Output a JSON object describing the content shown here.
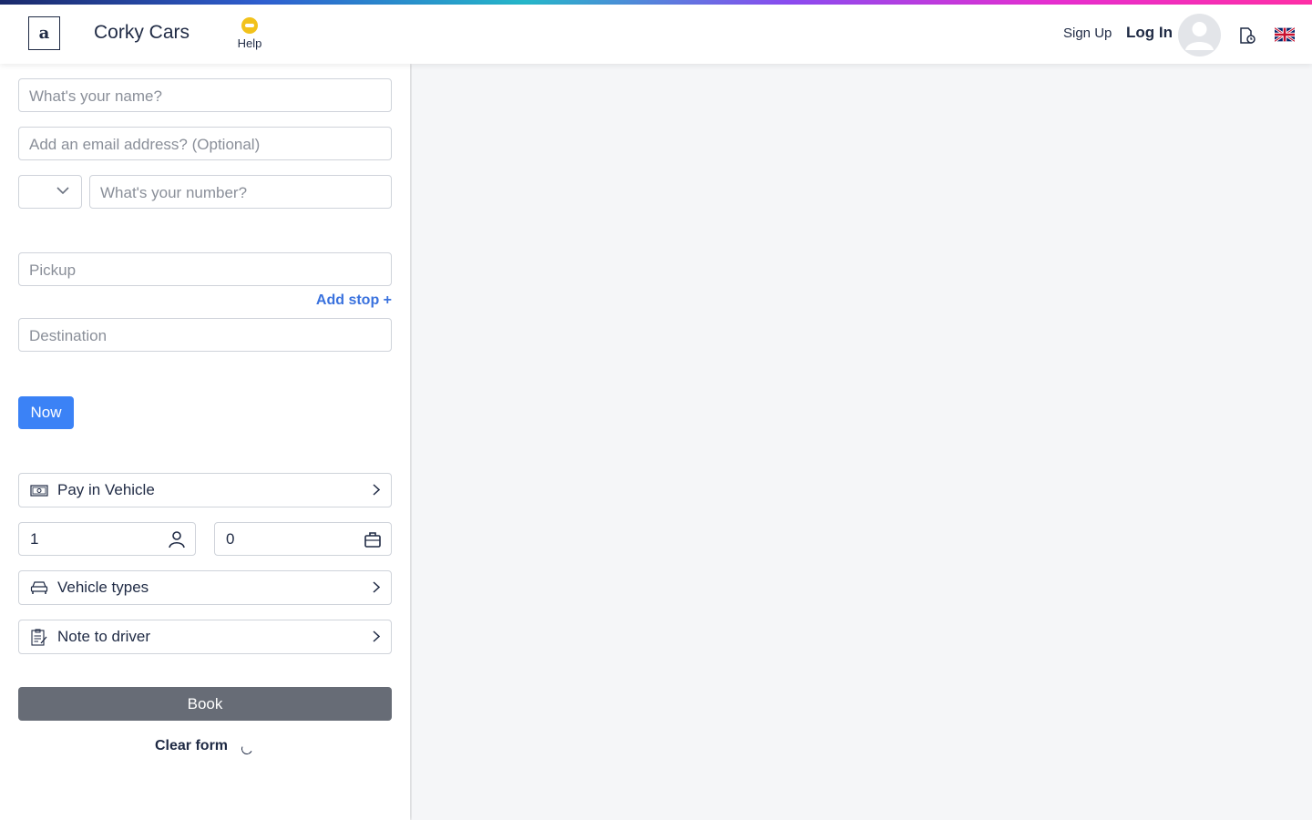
{
  "header": {
    "logo_letter": "a",
    "brand": "Corky Cars",
    "help_label": "Help",
    "signup_label": "Sign Up",
    "login_label": "Log In",
    "icons": [
      "help-icon",
      "avatar-icon",
      "document-icon",
      "uk-flag-icon"
    ]
  },
  "form": {
    "name_placeholder": "What's your name?",
    "email_placeholder": "Add an email address? (Optional)",
    "country_code": "",
    "phone_placeholder": "What's your number?",
    "pickup_placeholder": "Pickup",
    "add_stop_label": "Add stop +",
    "destination_placeholder": "Destination",
    "now_label": "Now",
    "payment_label": "Pay in Vehicle",
    "passengers_value": "1",
    "luggage_value": "0",
    "vehicle_types_label": "Vehicle types",
    "note_label": "Note to driver",
    "book_label": "Book",
    "clear_label": "Clear form"
  },
  "colors": {
    "accent_blue": "#3b82f6",
    "link_blue": "#3a72de",
    "book_gray": "#676c76",
    "help_yellow": "#f2c21b"
  }
}
